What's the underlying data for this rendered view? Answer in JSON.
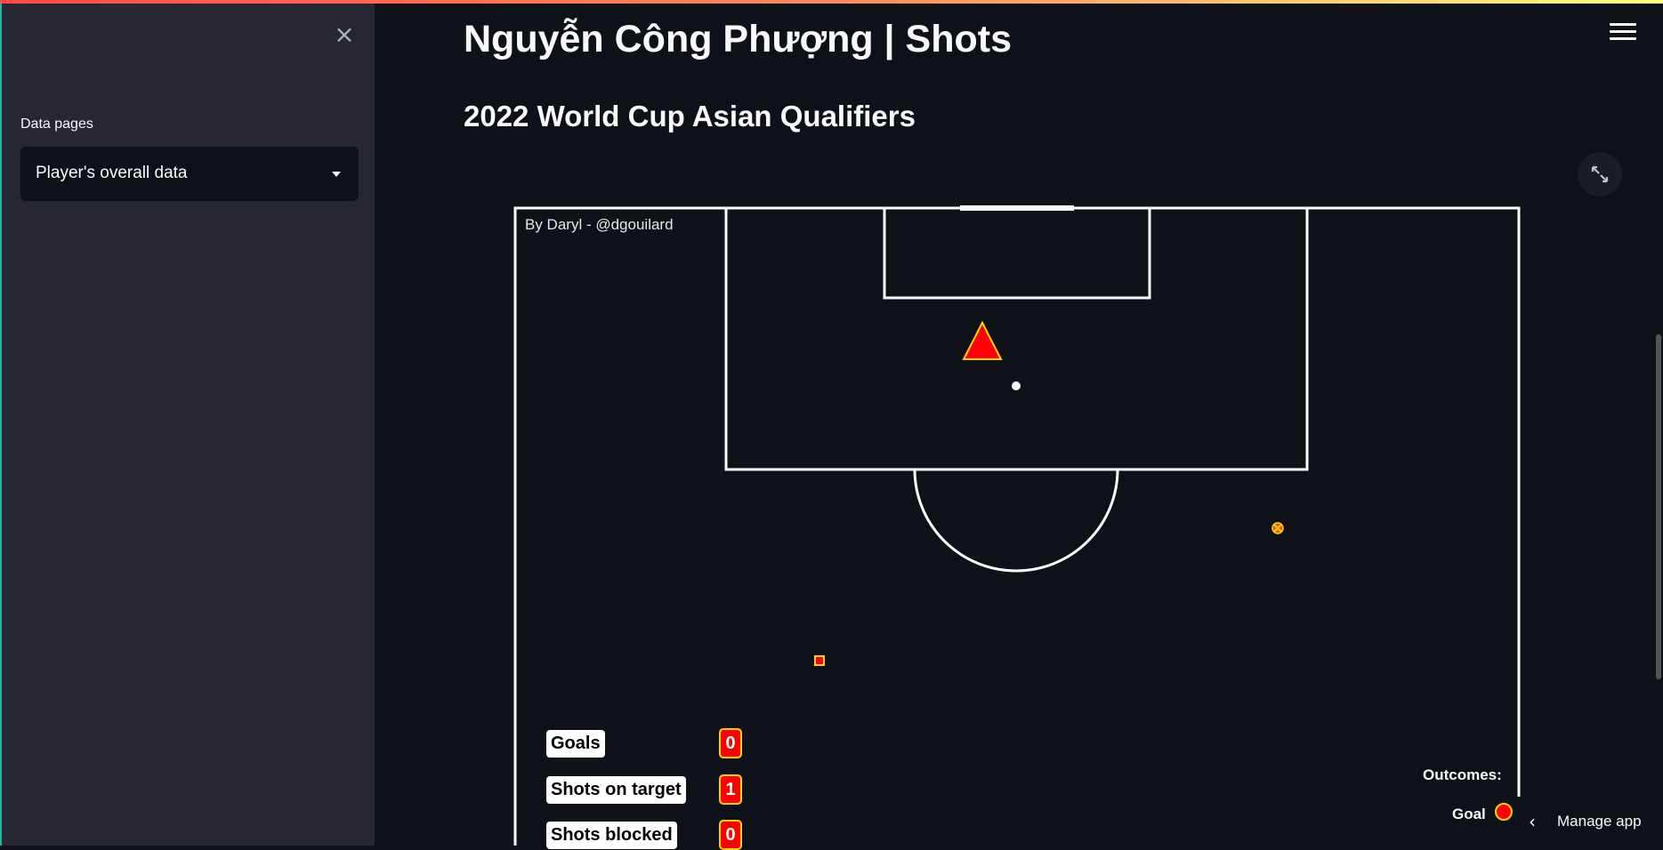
{
  "sidebar": {
    "close_icon": "close-icon",
    "label": "Data pages",
    "select_value": "Player's overall data"
  },
  "header": {
    "title": "Nguyễn Công Phượng | Shots",
    "subtitle": "2022 World Cup Asian Qualifiers",
    "menu_icon": "hamburger-menu-icon",
    "expand_icon": "fullscreen-expand-icon"
  },
  "chart_data": {
    "type": "scatter",
    "title": "",
    "credit": "By Daryl - @dgouilard",
    "stats": [
      {
        "label": "Goals",
        "value": "0"
      },
      {
        "label": "Shots on target",
        "value": "1"
      },
      {
        "label": "Shots blocked",
        "value": "0"
      }
    ],
    "legend": {
      "title": "Outcomes:",
      "items": [
        "Goal"
      ]
    },
    "colors": {
      "marker_fill": "#ff0000",
      "marker_edge": "#ffd700",
      "pitch_lines": "#ffffff"
    }
  },
  "footer": {
    "manage_label": "Manage app"
  }
}
